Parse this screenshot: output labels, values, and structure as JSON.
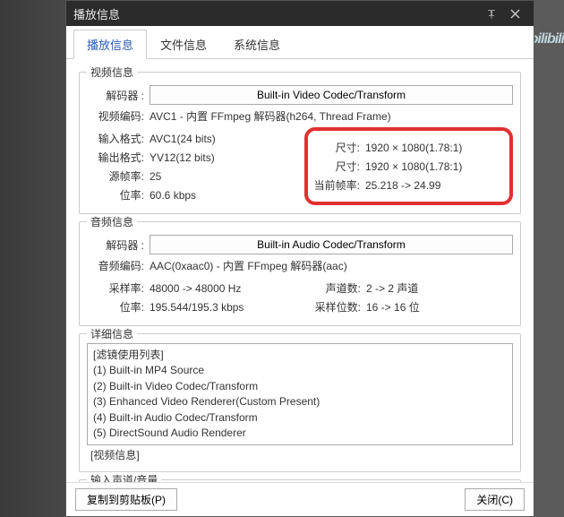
{
  "watermark": "ɔilibili",
  "titlebar": {
    "title": "播放信息"
  },
  "tabs": {
    "t0": "播放信息",
    "t1": "文件信息",
    "t2": "系统信息"
  },
  "video": {
    "group_title": "视频信息",
    "decoder_label": "解码器 :",
    "decoder_button": "Built-in Video Codec/Transform",
    "codec_label": "视频编码:",
    "codec_value": "AVC1 - 内置 FFmpeg 解码器(h264, Thread Frame)",
    "input_label": "输入格式:",
    "input_value": "AVC1(24 bits)",
    "output_label": "输出格式:",
    "output_value": "YV12(12 bits)",
    "srcfps_label": "源帧率:",
    "srcfps_value": "25",
    "bitrate_label": "位率:",
    "bitrate_value": "60.6 kbps",
    "size1_label": "尺寸:",
    "size1_value": "1920 × 1080(1.78:1)",
    "size2_label": "尺寸:",
    "size2_value": "1920 × 1080(1.78:1)",
    "curfps_label": "当前帧率:",
    "curfps_value": "25.218 -> 24.99"
  },
  "audio": {
    "group_title": "音频信息",
    "decoder_label": "解码器 :",
    "decoder_button": "Built-in Audio Codec/Transform",
    "codec_label": "音频编码:",
    "codec_value": "AAC(0xaac0) - 内置 FFmpeg 解码器(aac)",
    "sample_label": "采样率:",
    "sample_value": "48000 -> 48000 Hz",
    "bitrate_label": "位率:",
    "bitrate_value": "195.544/195.3 kbps",
    "channels_label": "声道数:",
    "channels_value": "2 -> 2 声道",
    "bits_label": "采样位数:",
    "bits_value": "16 -> 16 位"
  },
  "detail": {
    "group_title": "详细信息",
    "list_header": "[滤镜使用列表]",
    "items": [
      "(1) Built-in MP4 Source",
      "(2) Built-in Video Codec/Transform",
      "(3) Enhanced Video Renderer(Custom Present)",
      "(4) Built-in Audio Codec/Transform",
      "(5) DirectSound Audio Renderer"
    ],
    "truncated": "[视频信息]"
  },
  "channel": {
    "group_title": "输入声道/音量"
  },
  "footer": {
    "copy": "复制到剪贴板(P)",
    "close": "关闭(C)"
  }
}
